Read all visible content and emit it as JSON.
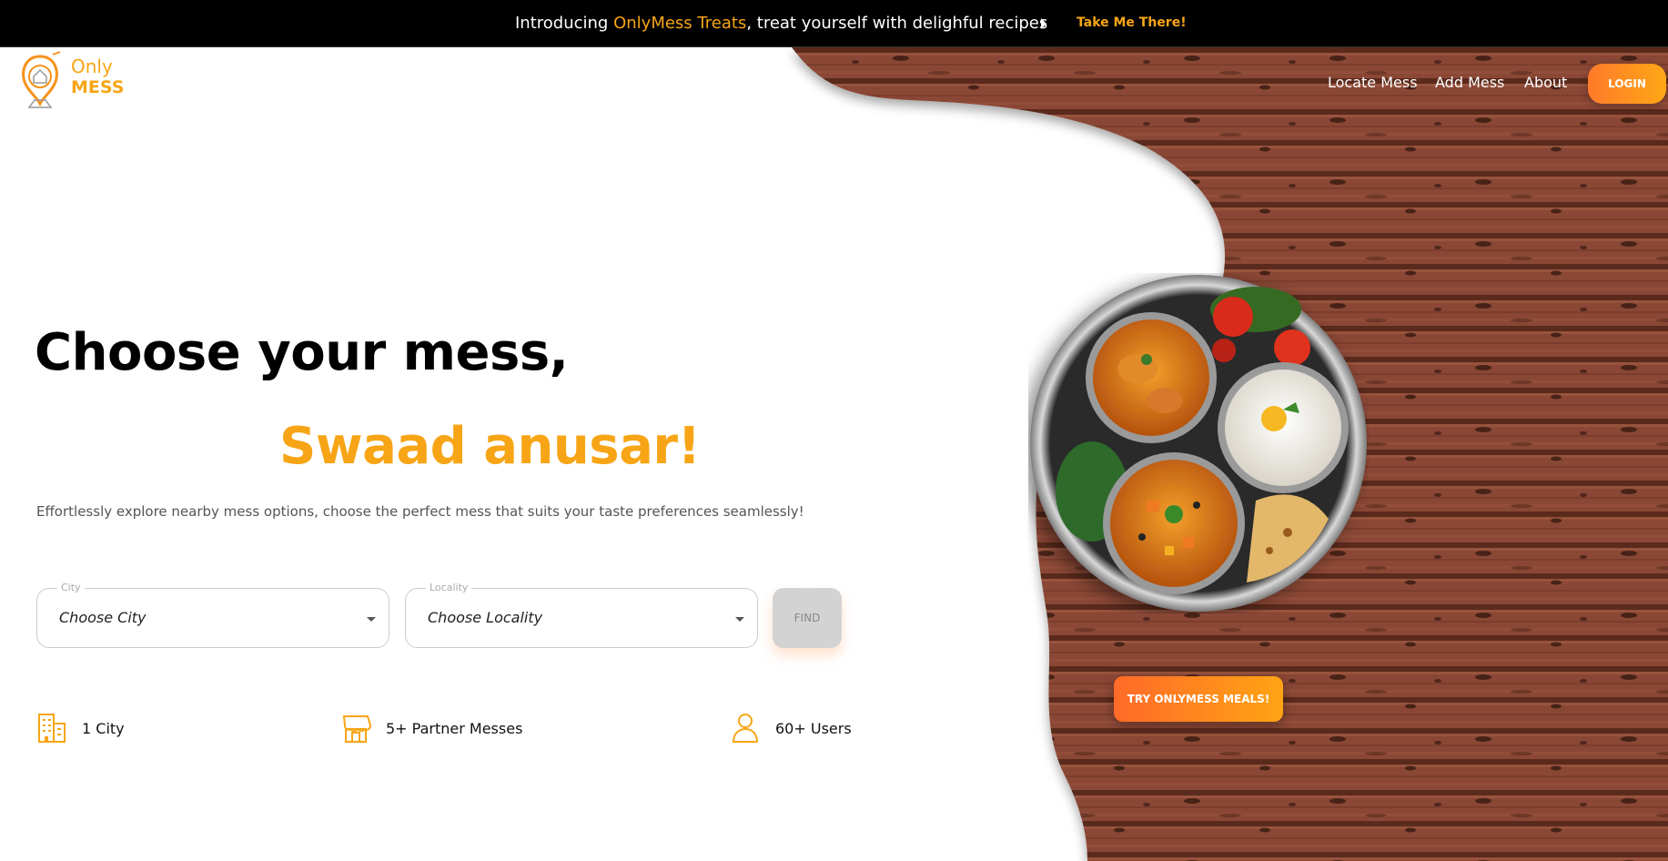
{
  "announcement": {
    "prefix": "Introducing ",
    "highlight": "OnlyMess Treats",
    "suffix": ", treat yourself with delighful recipes",
    "link_label": "Take Me There!"
  },
  "logo": {
    "line1": "Only",
    "line2": "MESS"
  },
  "nav": {
    "items": [
      {
        "label": "Locate Mess"
      },
      {
        "label": "Add Mess"
      },
      {
        "label": "About"
      }
    ],
    "login_label": "LOGIN"
  },
  "hero": {
    "title": "Choose your mess,",
    "subtitle": "Swaad anusar!",
    "description": "Effortlessly explore nearby mess options, choose the perfect mess that suits your taste preferences seamlessly!"
  },
  "search": {
    "city": {
      "label": "City",
      "value": "Choose City"
    },
    "locality": {
      "label": "Locality",
      "value": "Choose Locality"
    },
    "find_label": "FIND"
  },
  "stats": [
    {
      "icon": "building-icon",
      "label": "1 City"
    },
    {
      "icon": "store-icon",
      "label": "5+ Partner Messes"
    },
    {
      "icon": "user-icon",
      "label": "60+ Users"
    }
  ],
  "cta": {
    "label": "TRY ONLYMESS MEALS!"
  },
  "colors": {
    "accent": "#f7a516",
    "button_start": "#ff6a28",
    "button_end": "#ffa414",
    "wood": "#7a3d2a"
  }
}
